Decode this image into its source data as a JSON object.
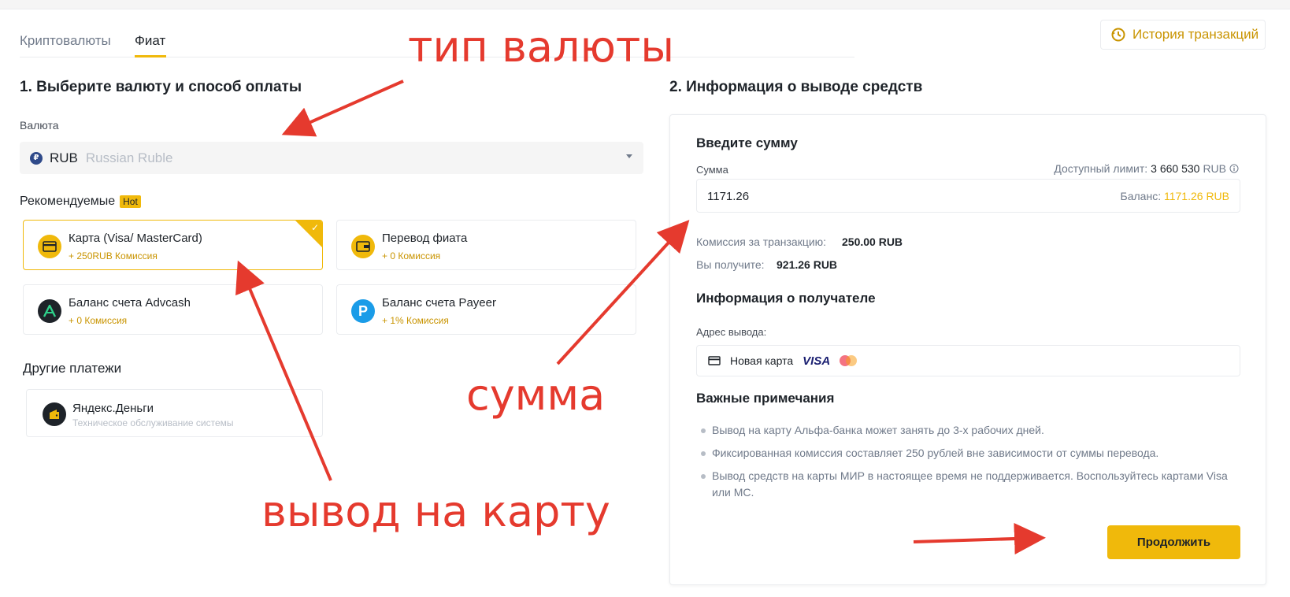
{
  "tabs": [
    {
      "label": "Криптовалюты",
      "active": false
    },
    {
      "label": "Фиат",
      "active": true
    }
  ],
  "history_button": {
    "label": "История транзакций",
    "icon": "history-icon"
  },
  "left": {
    "section_title": "1. Выберите валюту и способ оплаты",
    "currency_label": "Валюта",
    "currency": {
      "badge": "₽",
      "code": "RUB",
      "name": "Russian Ruble"
    },
    "recommended_label": "Рекомендуемые",
    "hot_badge": "Hot",
    "methods": [
      {
        "title": "Карта (Visa/ MasterCard)",
        "fee": "+ 250RUB Комиссия",
        "selected": true,
        "icon": "card-icon"
      },
      {
        "title": "Перевод фиата",
        "fee": "+ 0 Комиссия",
        "selected": false,
        "icon": "wallet-icon"
      },
      {
        "title": "Баланс счета Advcash",
        "fee": "+ 0 Комиссия",
        "selected": false,
        "icon": "advcash-icon"
      },
      {
        "title": "Баланс счета Payeer",
        "fee": "+ 1% Комиссия",
        "selected": false,
        "icon": "payeer-icon"
      }
    ],
    "other_label": "Другие платежи",
    "other_methods": [
      {
        "title": "Яндекс.Деньги",
        "status": "Техническое обслуживание системы",
        "icon": "yandex-money-icon"
      }
    ]
  },
  "right": {
    "section_title": "2. Информация о выводе средств",
    "amount_heading": "Введите сумму",
    "amount_label": "Сумма",
    "limit_label": "Доступный лимит:",
    "limit_value": "3 660 530",
    "limit_currency": "RUB",
    "amount_value": "1171.26",
    "balance_label": "Баланс:",
    "balance_value": "1171.26 RUB",
    "fee_label": "Комиссия за транзакцию:",
    "fee_value": "250.00 RUB",
    "receive_label": "Вы получите:",
    "receive_value": "921.26 RUB",
    "recipient_heading": "Информация о получателе",
    "address_label": "Адрес вывода:",
    "address_value": "Новая карта",
    "visa_text": "VISA",
    "notes_heading": "Важные примечания",
    "notes": [
      "Вывод на карту Альфа-банка может занять до 3-х рабочих дней.",
      "Фиксированная комиссия составляет 250 рублей вне зависимости от суммы перевода.",
      "Вывод средств на карты МИР в настоящее время не поддерживается. Воспользуйтесь картами Visa или MC."
    ],
    "continue_button": "Продолжить"
  },
  "annotations": {
    "currency_type": "тип валюты",
    "amount": "сумма",
    "card_withdrawal": "вывод на карту"
  },
  "colors": {
    "accent": "#f0b90b",
    "annotation": "#e53a2e",
    "accent_text": "#c99400"
  }
}
